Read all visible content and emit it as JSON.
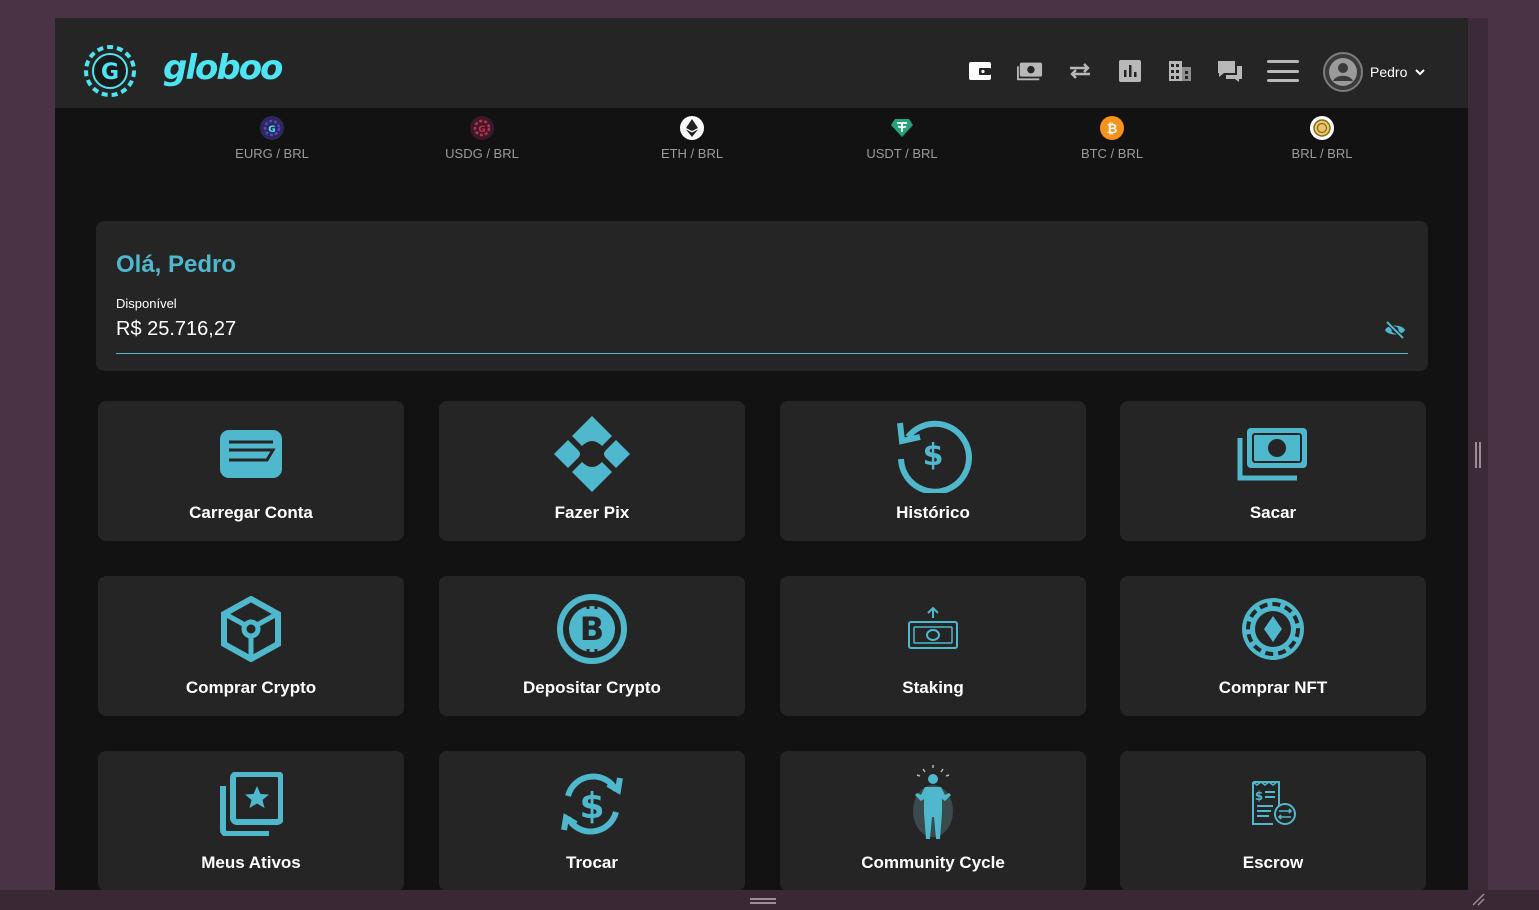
{
  "header": {
    "logo_text": "globoo",
    "nav_icons": [
      "wallet-icon",
      "cash-icon",
      "swap-icon",
      "chart-icon",
      "building-icon",
      "chat-icon",
      "menu-icon"
    ],
    "user_name": "Pedro"
  },
  "ticker": [
    {
      "label": "EURG / BRL",
      "icon": "eurg-coin-icon",
      "color": "#3b2a8c"
    },
    {
      "label": "USDG / BRL",
      "icon": "usdg-coin-icon",
      "color": "#7a1f3a"
    },
    {
      "label": "ETH / BRL",
      "icon": "eth-coin-icon",
      "color": "#ffffff"
    },
    {
      "label": "USDT / BRL",
      "icon": "usdt-coin-icon",
      "color": "#26a17b"
    },
    {
      "label": "BTC / BRL",
      "icon": "btc-coin-icon",
      "color": "#f7931a"
    },
    {
      "label": "BRL / BRL",
      "icon": "brl-coin-icon",
      "color": "#e8c66e"
    }
  ],
  "balance": {
    "greeting": "Olá, Pedro",
    "available_label": "Disponível",
    "available_value": "R$ 25.716,27"
  },
  "tiles": [
    {
      "label": "Carregar Conta",
      "icon": "card-icon"
    },
    {
      "label": "Fazer Pix",
      "icon": "pix-icon"
    },
    {
      "label": "Histórico",
      "icon": "history-icon"
    },
    {
      "label": "Sacar",
      "icon": "withdraw-cash-icon"
    },
    {
      "label": "Comprar Crypto",
      "icon": "crypto-cube-icon"
    },
    {
      "label": "Depositar Crypto",
      "icon": "bitcoin-icon"
    },
    {
      "label": "Staking",
      "icon": "staking-icon"
    },
    {
      "label": "Comprar NFT",
      "icon": "nft-token-icon"
    },
    {
      "label": "Meus Ativos",
      "icon": "assets-star-icon"
    },
    {
      "label": "Trocar",
      "icon": "exchange-dollar-icon"
    },
    {
      "label": "Community Cycle",
      "icon": "person-icon"
    },
    {
      "label": "Escrow",
      "icon": "escrow-receipt-icon"
    }
  ],
  "colors": {
    "accent": "#4fb8cc",
    "card_bg": "#252525",
    "page_bg": "#121212",
    "logo": "#4ee5f3"
  }
}
